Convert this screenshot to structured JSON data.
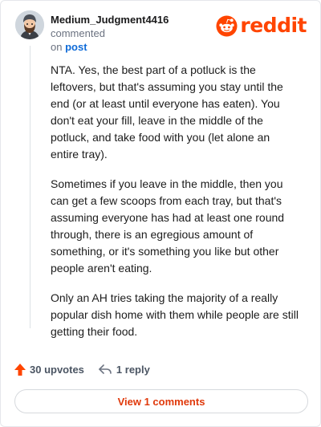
{
  "header": {
    "username": "Medium_Judgment4416",
    "action_text": "commented",
    "on_text": "on",
    "target_link": "post"
  },
  "brand": {
    "wordmark": "reddit",
    "accent_color": "#ff4500",
    "link_color": "#0f6bd8"
  },
  "comment": {
    "paragraphs": [
      "NTA. Yes, the best part of a potluck is the leftovers, but that's assuming you stay until the end (or at least until everyone has eaten). You don't eat your fill, leave in the middle of the potluck, and take food with you (let alone an entire tray).",
      "Sometimes if you leave in the middle, then you can get a few scoops from each tray, but that's assuming everyone has had at least one round through, there is an egregious amount of something, or it's something you like but other people aren't eating.",
      "Only an AH tries taking the majority of a really popular dish home with them while people are still getting their food."
    ]
  },
  "actions": {
    "upvotes_label": "30 upvotes",
    "replies_label": "1 reply",
    "upvote_icon": "upvote-arrow-icon",
    "reply_icon": "reply-arrow-icon"
  },
  "footer": {
    "view_comments_label": "View 1 comments"
  }
}
